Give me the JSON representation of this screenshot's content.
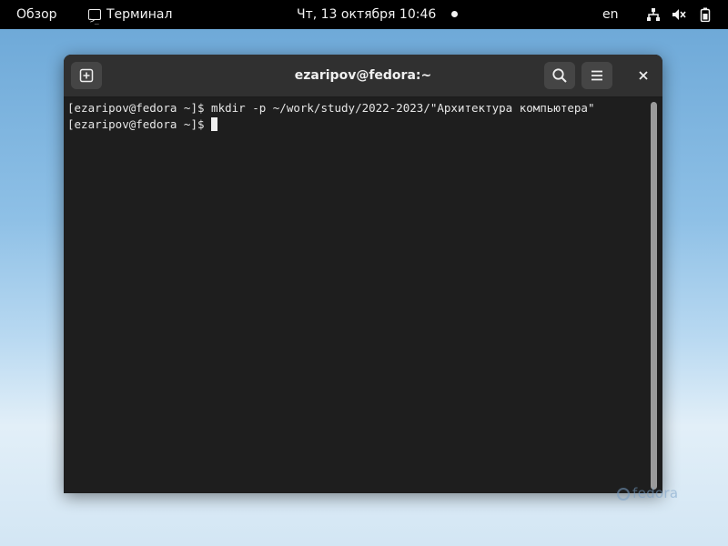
{
  "topbar": {
    "overview_label": "Обзор",
    "app_label": "Терминал",
    "clock": "Чт, 13 октября  10:46",
    "keyboard_layout": "en",
    "icons": [
      "terminal-icon",
      "network-icon",
      "volume-muted-icon",
      "battery-icon"
    ]
  },
  "window": {
    "title": "ezaripov@fedora:~",
    "icons": [
      "new-tab-icon",
      "search-icon",
      "hamburger-menu-icon",
      "close-icon"
    ]
  },
  "terminal": {
    "lines": [
      "[ezaripov@fedora ~]$ mkdir -p ~/work/study/2022-2023/\"Архитектура компьютера\"",
      "[ezaripov@fedora ~]$ "
    ]
  },
  "wallpaper": {
    "watermark": "fedora"
  },
  "colors": {
    "topbar_bg": "#000000",
    "headerbar_bg": "#303030",
    "terminal_bg": "#1e1e1e",
    "terminal_fg": "#e6e6e6"
  }
}
